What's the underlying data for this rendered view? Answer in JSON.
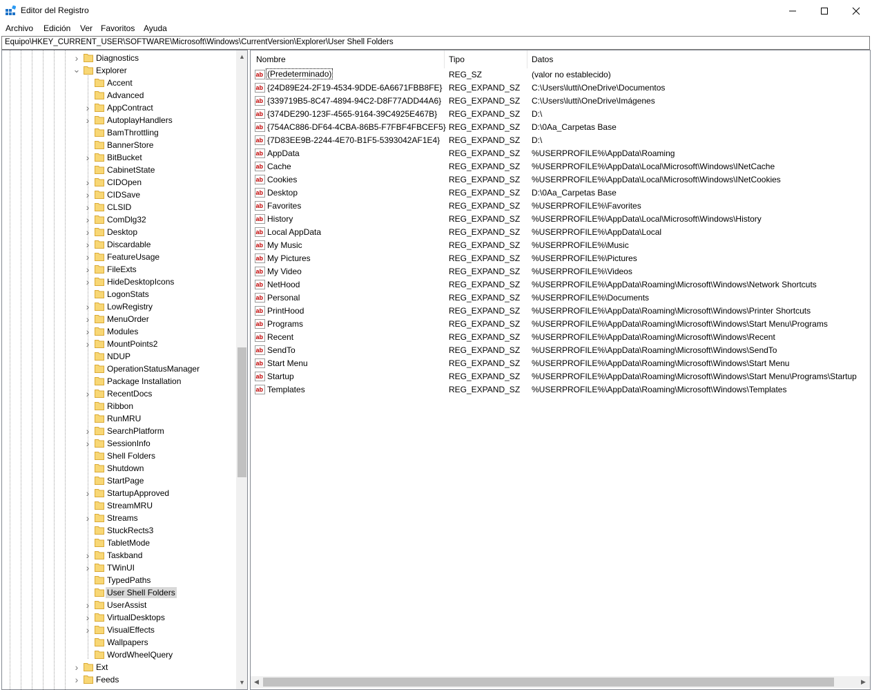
{
  "window": {
    "title": "Editor del Registro",
    "minimize": "—",
    "maximize": "☐",
    "close": "✕"
  },
  "menu": [
    "Archivo",
    "Edición",
    "Ver",
    "Favoritos",
    "Ayuda"
  ],
  "address": "Equipo\\HKEY_CURRENT_USER\\SOFTWARE\\Microsoft\\Windows\\CurrentVersion\\Explorer\\User Shell Folders",
  "tree": [
    {
      "label": "Diagnostics",
      "level": 1,
      "expander": "collapsed"
    },
    {
      "label": "Explorer",
      "level": 1,
      "expander": "expanded"
    },
    {
      "label": "Accent",
      "level": 2,
      "expander": "none"
    },
    {
      "label": "Advanced",
      "level": 2,
      "expander": "none"
    },
    {
      "label": "AppContract",
      "level": 2,
      "expander": "collapsed"
    },
    {
      "label": "AutoplayHandlers",
      "level": 2,
      "expander": "collapsed"
    },
    {
      "label": "BamThrottling",
      "level": 2,
      "expander": "none"
    },
    {
      "label": "BannerStore",
      "level": 2,
      "expander": "none"
    },
    {
      "label": "BitBucket",
      "level": 2,
      "expander": "collapsed"
    },
    {
      "label": "CabinetState",
      "level": 2,
      "expander": "none"
    },
    {
      "label": "CIDOpen",
      "level": 2,
      "expander": "collapsed"
    },
    {
      "label": "CIDSave",
      "level": 2,
      "expander": "collapsed"
    },
    {
      "label": "CLSID",
      "level": 2,
      "expander": "collapsed"
    },
    {
      "label": "ComDlg32",
      "level": 2,
      "expander": "collapsed"
    },
    {
      "label": "Desktop",
      "level": 2,
      "expander": "collapsed"
    },
    {
      "label": "Discardable",
      "level": 2,
      "expander": "collapsed"
    },
    {
      "label": "FeatureUsage",
      "level": 2,
      "expander": "collapsed"
    },
    {
      "label": "FileExts",
      "level": 2,
      "expander": "collapsed"
    },
    {
      "label": "HideDesktopIcons",
      "level": 2,
      "expander": "collapsed"
    },
    {
      "label": "LogonStats",
      "level": 2,
      "expander": "none"
    },
    {
      "label": "LowRegistry",
      "level": 2,
      "expander": "collapsed"
    },
    {
      "label": "MenuOrder",
      "level": 2,
      "expander": "collapsed"
    },
    {
      "label": "Modules",
      "level": 2,
      "expander": "collapsed"
    },
    {
      "label": "MountPoints2",
      "level": 2,
      "expander": "collapsed"
    },
    {
      "label": "NDUP",
      "level": 2,
      "expander": "none"
    },
    {
      "label": "OperationStatusManager",
      "level": 2,
      "expander": "none"
    },
    {
      "label": "Package Installation",
      "level": 2,
      "expander": "none"
    },
    {
      "label": "RecentDocs",
      "level": 2,
      "expander": "collapsed"
    },
    {
      "label": "Ribbon",
      "level": 2,
      "expander": "none"
    },
    {
      "label": "RunMRU",
      "level": 2,
      "expander": "none"
    },
    {
      "label": "SearchPlatform",
      "level": 2,
      "expander": "collapsed"
    },
    {
      "label": "SessionInfo",
      "level": 2,
      "expander": "collapsed"
    },
    {
      "label": "Shell Folders",
      "level": 2,
      "expander": "none"
    },
    {
      "label": "Shutdown",
      "level": 2,
      "expander": "none"
    },
    {
      "label": "StartPage",
      "level": 2,
      "expander": "none"
    },
    {
      "label": "StartupApproved",
      "level": 2,
      "expander": "collapsed"
    },
    {
      "label": "StreamMRU",
      "level": 2,
      "expander": "none"
    },
    {
      "label": "Streams",
      "level": 2,
      "expander": "collapsed"
    },
    {
      "label": "StuckRects3",
      "level": 2,
      "expander": "none"
    },
    {
      "label": "TabletMode",
      "level": 2,
      "expander": "none"
    },
    {
      "label": "Taskband",
      "level": 2,
      "expander": "collapsed"
    },
    {
      "label": "TWinUI",
      "level": 2,
      "expander": "collapsed"
    },
    {
      "label": "TypedPaths",
      "level": 2,
      "expander": "none"
    },
    {
      "label": "User Shell Folders",
      "level": 2,
      "expander": "none",
      "selected": true
    },
    {
      "label": "UserAssist",
      "level": 2,
      "expander": "collapsed"
    },
    {
      "label": "VirtualDesktops",
      "level": 2,
      "expander": "collapsed"
    },
    {
      "label": "VisualEffects",
      "level": 2,
      "expander": "collapsed"
    },
    {
      "label": "Wallpapers",
      "level": 2,
      "expander": "none"
    },
    {
      "label": "WordWheelQuery",
      "level": 2,
      "expander": "none"
    },
    {
      "label": "Ext",
      "level": 1,
      "expander": "collapsed"
    },
    {
      "label": "Feeds",
      "level": 1,
      "expander": "collapsed"
    }
  ],
  "columns": {
    "name": "Nombre",
    "type": "Tipo",
    "data": "Datos"
  },
  "values": [
    {
      "name": "(Predeterminado)",
      "type": "REG_SZ",
      "data": "(valor no establecido)"
    },
    {
      "name": "{24D89E24-2F19-4534-9DDE-6A6671FBB8FE}",
      "type": "REG_EXPAND_SZ",
      "data": "C:\\Users\\lutti\\OneDrive\\Documentos"
    },
    {
      "name": "{339719B5-8C47-4894-94C2-D8F77ADD44A6}",
      "type": "REG_EXPAND_SZ",
      "data": "C:\\Users\\lutti\\OneDrive\\Imágenes"
    },
    {
      "name": "{374DE290-123F-4565-9164-39C4925E467B}",
      "type": "REG_EXPAND_SZ",
      "data": "D:\\"
    },
    {
      "name": "{754AC886-DF64-4CBA-86B5-F7FBF4FBCEF5}",
      "type": "REG_EXPAND_SZ",
      "data": "D:\\0Aa_Carpetas Base"
    },
    {
      "name": "{7D83EE9B-2244-4E70-B1F5-5393042AF1E4}",
      "type": "REG_EXPAND_SZ",
      "data": "D:\\"
    },
    {
      "name": "AppData",
      "type": "REG_EXPAND_SZ",
      "data": "%USERPROFILE%\\AppData\\Roaming"
    },
    {
      "name": "Cache",
      "type": "REG_EXPAND_SZ",
      "data": "%USERPROFILE%\\AppData\\Local\\Microsoft\\Windows\\INetCache"
    },
    {
      "name": "Cookies",
      "type": "REG_EXPAND_SZ",
      "data": "%USERPROFILE%\\AppData\\Local\\Microsoft\\Windows\\INetCookies"
    },
    {
      "name": "Desktop",
      "type": "REG_EXPAND_SZ",
      "data": "D:\\0Aa_Carpetas Base"
    },
    {
      "name": "Favorites",
      "type": "REG_EXPAND_SZ",
      "data": "%USERPROFILE%\\Favorites"
    },
    {
      "name": "History",
      "type": "REG_EXPAND_SZ",
      "data": "%USERPROFILE%\\AppData\\Local\\Microsoft\\Windows\\History"
    },
    {
      "name": "Local AppData",
      "type": "REG_EXPAND_SZ",
      "data": "%USERPROFILE%\\AppData\\Local"
    },
    {
      "name": "My Music",
      "type": "REG_EXPAND_SZ",
      "data": "%USERPROFILE%\\Music"
    },
    {
      "name": "My Pictures",
      "type": "REG_EXPAND_SZ",
      "data": "%USERPROFILE%\\Pictures"
    },
    {
      "name": "My Video",
      "type": "REG_EXPAND_SZ",
      "data": "%USERPROFILE%\\Videos"
    },
    {
      "name": "NetHood",
      "type": "REG_EXPAND_SZ",
      "data": "%USERPROFILE%\\AppData\\Roaming\\Microsoft\\Windows\\Network Shortcuts"
    },
    {
      "name": "Personal",
      "type": "REG_EXPAND_SZ",
      "data": "%USERPROFILE%\\Documents"
    },
    {
      "name": "PrintHood",
      "type": "REG_EXPAND_SZ",
      "data": "%USERPROFILE%\\AppData\\Roaming\\Microsoft\\Windows\\Printer Shortcuts"
    },
    {
      "name": "Programs",
      "type": "REG_EXPAND_SZ",
      "data": "%USERPROFILE%\\AppData\\Roaming\\Microsoft\\Windows\\Start Menu\\Programs"
    },
    {
      "name": "Recent",
      "type": "REG_EXPAND_SZ",
      "data": "%USERPROFILE%\\AppData\\Roaming\\Microsoft\\Windows\\Recent"
    },
    {
      "name": "SendTo",
      "type": "REG_EXPAND_SZ",
      "data": "%USERPROFILE%\\AppData\\Roaming\\Microsoft\\Windows\\SendTo"
    },
    {
      "name": "Start Menu",
      "type": "REG_EXPAND_SZ",
      "data": "%USERPROFILE%\\AppData\\Roaming\\Microsoft\\Windows\\Start Menu"
    },
    {
      "name": "Startup",
      "type": "REG_EXPAND_SZ",
      "data": "%USERPROFILE%\\AppData\\Roaming\\Microsoft\\Windows\\Start Menu\\Programs\\Startup"
    },
    {
      "name": "Templates",
      "type": "REG_EXPAND_SZ",
      "data": "%USERPROFILE%\\AppData\\Roaming\\Microsoft\\Windows\\Templates"
    }
  ],
  "icons": {
    "app": "registry-editor-icon",
    "folder": "folder-icon",
    "value": "string-value-icon",
    "value_glyph": "ab"
  },
  "colors": {
    "folder": "#f8d775",
    "folder_edge": "#d9a935",
    "value_icon": "#c00000",
    "selection": "#d9d9d9"
  },
  "scroll": {
    "tree_up": "▲",
    "tree_down": "▼",
    "list_left": "◀",
    "list_right": "▶"
  }
}
